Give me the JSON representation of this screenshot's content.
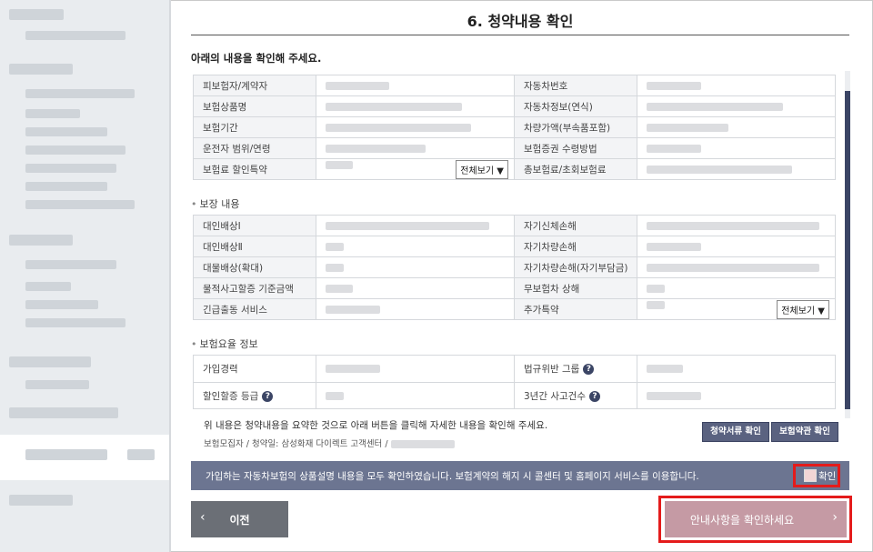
{
  "page": {
    "title": "6. 청약내용 확인",
    "intro": "아래의 내용을 확인해 주세요."
  },
  "contract": {
    "rows": [
      {
        "left_label": "피보험자/계약자",
        "right_label": "자동차번호"
      },
      {
        "left_label": "보험상품명",
        "right_label": "자동차정보(연식)"
      },
      {
        "left_label": "보험기간",
        "right_label": "차량가액(부속품포함)"
      },
      {
        "left_label": "운전자 범위/연령",
        "right_label": "보험증권 수령방법"
      },
      {
        "left_label": "보험료 할인특약",
        "right_label": "총보험료/초회보험료"
      }
    ],
    "view_all_label": "전체보기"
  },
  "coverage": {
    "section_title": "보장 내용",
    "rows": [
      {
        "left_label": "대인배상Ⅰ",
        "right_label": "자기신체손해"
      },
      {
        "left_label": "대인배상Ⅱ",
        "right_label": "자기차량손해"
      },
      {
        "left_label": "대물배상(확대)",
        "right_label": "자기차량손해(자기부담금)"
      },
      {
        "left_label": "물적사고할증 기준금액",
        "right_label": "무보험차 상해"
      },
      {
        "left_label": "긴급출동 서비스",
        "right_label": "추가특약"
      }
    ],
    "view_all_label": "전체보기"
  },
  "rate": {
    "section_title": "보험요율 정보",
    "rows": [
      {
        "left_label": "가입경력",
        "right_label": "법규위반 그룹"
      },
      {
        "left_label": "할인할증 등급",
        "right_label": "3년간 사고건수"
      }
    ]
  },
  "notes": {
    "summary": "위 내용은 청약내용을 요약한 것으로 아래 버튼을 클릭해 자세한 내용을 확인해 주세요.",
    "recruiter": "보험모집자 / 청약일: 삼성화재 다이렉트 고객센터 /",
    "btn_documents": "청약서류 확인",
    "btn_terms": "보험약관 확인"
  },
  "confirm": {
    "text": "가입하는 자동차보험의 상품설명 내용을 모두 확인하였습니다. 보험계약의 해지 시 콜센터 및 홈페이지 서비스를 이용합니다.",
    "check_label": "확인"
  },
  "nav": {
    "prev_label": "이전",
    "next_label": "안내사항을 확인하세요"
  }
}
